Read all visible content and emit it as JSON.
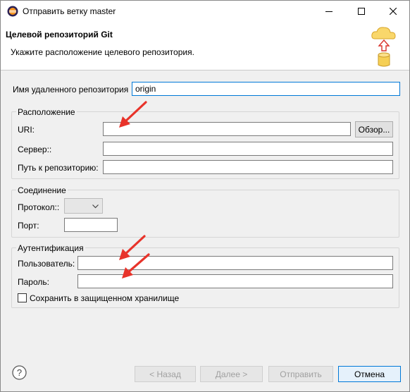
{
  "window": {
    "title": "Отправить ветку master"
  },
  "banner": {
    "title": "Целевой репозиторий Git",
    "description": "Укажите расположение целевого репозитория."
  },
  "remote": {
    "label": "Имя удаленного репозитория",
    "value": "origin"
  },
  "location": {
    "title": "Расположение",
    "uri_label": "URI:",
    "uri_value": "",
    "browse_label": "Обзор...",
    "server_label": "Сервер::",
    "server_value": "",
    "path_label": "Путь к репозиторию:",
    "path_value": ""
  },
  "connection": {
    "title": "Соединение",
    "protocol_label": "Протокол::",
    "protocol_value": "",
    "port_label": "Порт:",
    "port_value": ""
  },
  "auth": {
    "title": "Аутентификация",
    "user_label": "Пользователь:",
    "user_value": "",
    "password_label": "Пароль:",
    "password_value": "",
    "store_label": "Сохранить в защищенном хранилище",
    "store_checked": false
  },
  "footer": {
    "back_label": "< Назад",
    "next_label": "Далее >",
    "push_label": "Отправить",
    "cancel_label": "Отмена"
  },
  "colors": {
    "accent": "#0078d7",
    "annotation_arrow": "#e8332a"
  }
}
